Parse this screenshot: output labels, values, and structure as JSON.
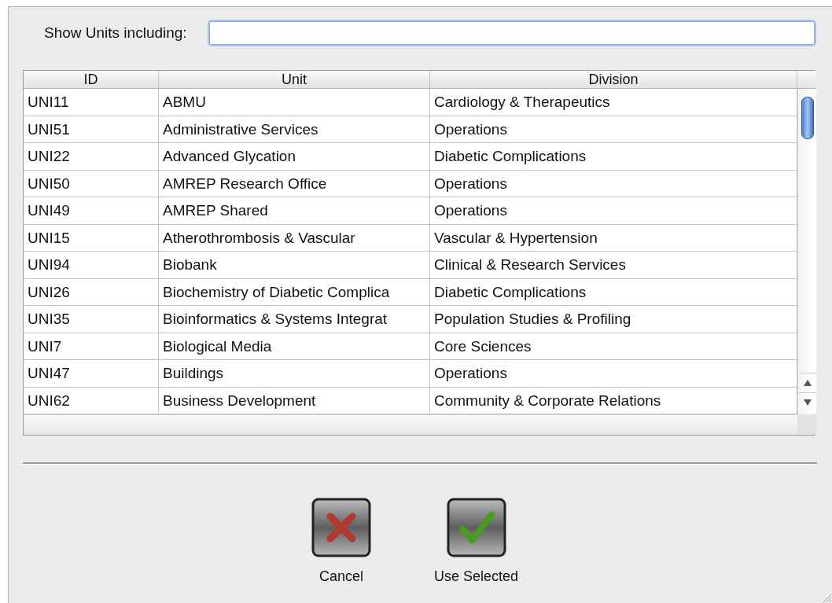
{
  "filter": {
    "label": "Show Units including:"
  },
  "table": {
    "columns": [
      "ID",
      "Unit",
      "Division"
    ],
    "rows": [
      {
        "id": "UNI11",
        "unit": "ABMU",
        "division": "Cardiology & Therapeutics"
      },
      {
        "id": "UNI51",
        "unit": "Administrative Services",
        "division": "Operations"
      },
      {
        "id": "UNI22",
        "unit": "Advanced Glycation",
        "division": "Diabetic Complications"
      },
      {
        "id": "UNI50",
        "unit": "AMREP Research Office",
        "division": "Operations"
      },
      {
        "id": "UNI49",
        "unit": "AMREP Shared",
        "division": "Operations"
      },
      {
        "id": "UNI15",
        "unit": "Atherothrombosis & Vascular",
        "division": "Vascular & Hypertension"
      },
      {
        "id": "UNI94",
        "unit": "Biobank",
        "division": "Clinical & Research Services"
      },
      {
        "id": "UNI26",
        "unit": "Biochemistry of Diabetic Complica",
        "division": "Diabetic Complications"
      },
      {
        "id": "UNI35",
        "unit": "Bioinformatics & Systems Integrat",
        "division": "Population Studies & Profiling"
      },
      {
        "id": "UNI7",
        "unit": "Biological Media",
        "division": "Core Sciences"
      },
      {
        "id": "UNI47",
        "unit": "Buildings",
        "division": "Operations"
      },
      {
        "id": "UNI62",
        "unit": "Business Development",
        "division": "Community & Corporate Relations"
      }
    ]
  },
  "buttons": [
    {
      "kind": "cancel",
      "label": "Cancel"
    },
    {
      "kind": "confirm",
      "label": "Use Selected"
    }
  ]
}
